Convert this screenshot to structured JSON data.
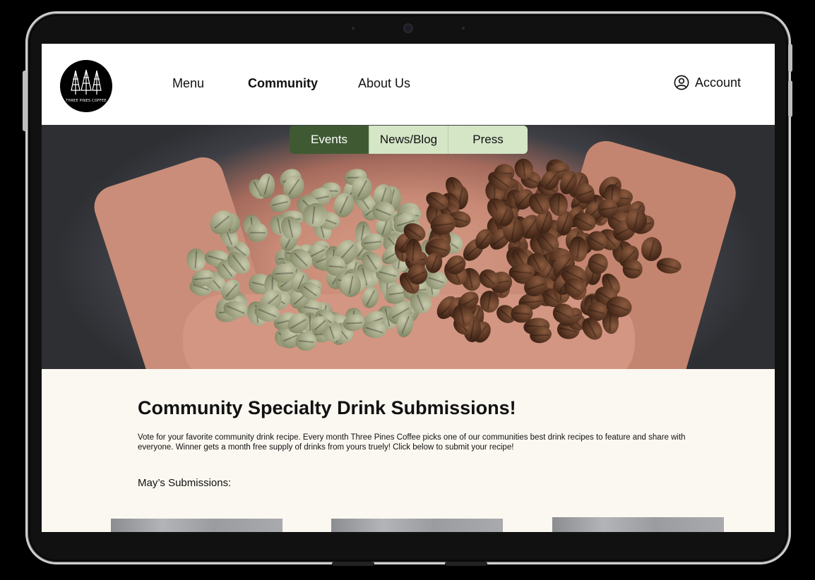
{
  "brand": {
    "logo_text": "THREE PINES COFFEE"
  },
  "nav": {
    "items": [
      {
        "label": "Menu"
      },
      {
        "label": "Community"
      },
      {
        "label": "About Us"
      }
    ],
    "active": "Community",
    "account_label": "Account"
  },
  "subnav": {
    "tabs": [
      {
        "label": "Events"
      },
      {
        "label": "News/Blog"
      },
      {
        "label": "Press"
      }
    ],
    "active": "Events"
  },
  "main": {
    "title": "Community Specialty Drink Submissions!",
    "description": "Vote for your favorite community drink recipe. Every month Three Pines Coffee picks one of our communities best drink recipes to feature and share with everyone. Winner gets a month free supply of drinks from yours truely! Click below to submit your recipe!",
    "section_label": "May’s Submissions:"
  },
  "icons": {
    "logo": "pine-trees-icon",
    "account": "user-circle-icon"
  },
  "colors": {
    "active_tab": "#3f5a32",
    "tab_bg": "#d4e6c6",
    "content_bg": "#fbf8f1"
  }
}
